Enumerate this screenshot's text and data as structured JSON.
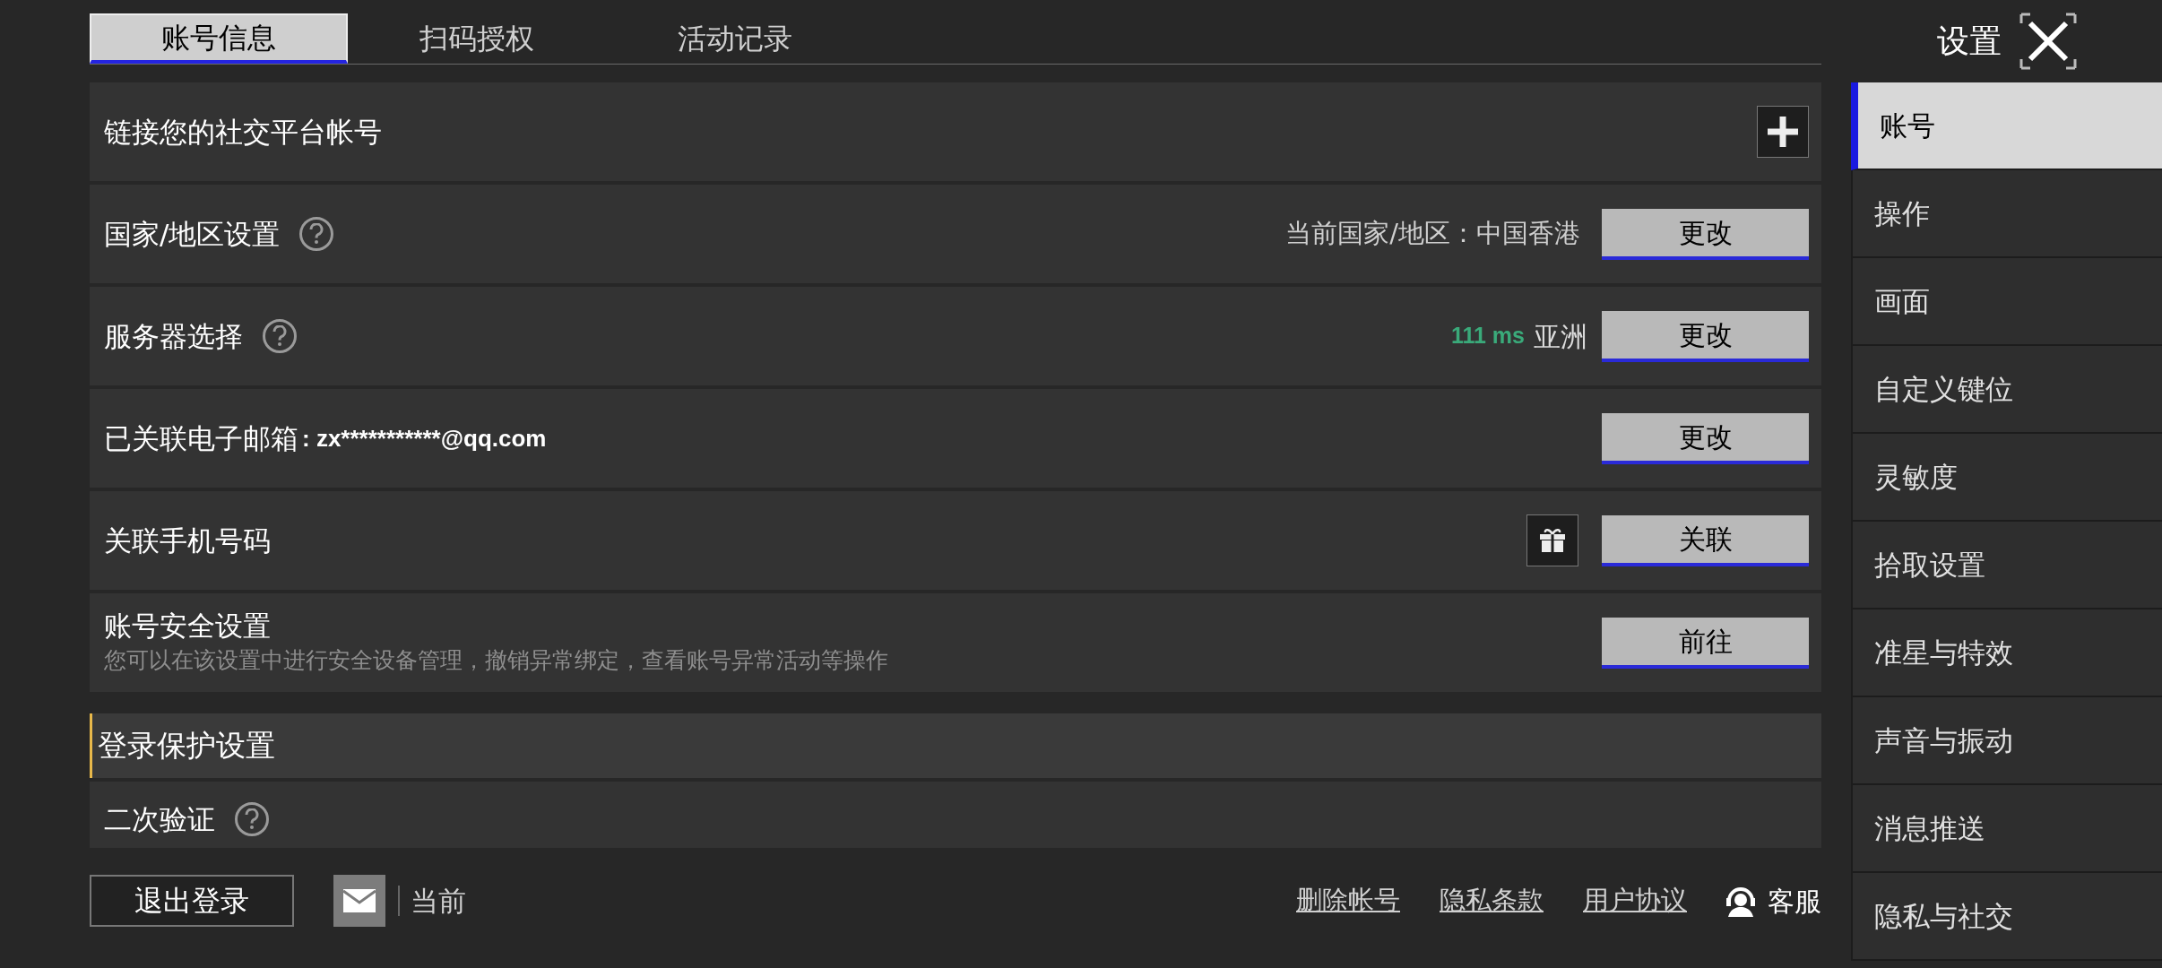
{
  "tabs": [
    {
      "label": "账号信息",
      "selected": true
    },
    {
      "label": "扫码授权",
      "selected": false
    },
    {
      "label": "活动记录",
      "selected": false
    }
  ],
  "header": {
    "title": "设置"
  },
  "rows": [
    {
      "kind": "add",
      "label": "链接您的社交平台帐号"
    },
    {
      "kind": "info",
      "label": "国家/地区设置",
      "help": true,
      "info": "当前国家/地区：中国香港",
      "button": "更改"
    },
    {
      "kind": "server",
      "label": "服务器选择",
      "help": true,
      "ping": "111 ms",
      "region": "亚洲",
      "button": "更改"
    },
    {
      "kind": "email",
      "label": "已关联电子邮箱",
      "value": ": zx***********@qq.com",
      "button": "更改"
    },
    {
      "kind": "gift",
      "label": "关联手机号码",
      "button": "关联"
    },
    {
      "kind": "description",
      "label": "账号安全设置",
      "description": "您可以在该设置中进行安全设备管理，撤销异常绑定，查看账号异常活动等操作",
      "button": "前往"
    }
  ],
  "section": {
    "title": "登录保护设置",
    "rows": [
      {
        "label": "二次验证",
        "help": true
      }
    ]
  },
  "footer": {
    "logout": "退出登录",
    "account": "当前",
    "links": [
      "删除帐号",
      "隐私条款",
      "用户协议"
    ],
    "support": "客服"
  },
  "sidebar": [
    {
      "label": "账号",
      "selected": true
    },
    {
      "label": "操作",
      "selected": false
    },
    {
      "label": "画面",
      "selected": false
    },
    {
      "label": "自定义键位",
      "selected": false
    },
    {
      "label": "灵敏度",
      "selected": false
    },
    {
      "label": "拾取设置",
      "selected": false
    },
    {
      "label": "准星与特效",
      "selected": false
    },
    {
      "label": "声音与振动",
      "selected": false
    },
    {
      "label": "消息推送",
      "selected": false
    },
    {
      "label": "隐私与社交",
      "selected": false
    }
  ]
}
